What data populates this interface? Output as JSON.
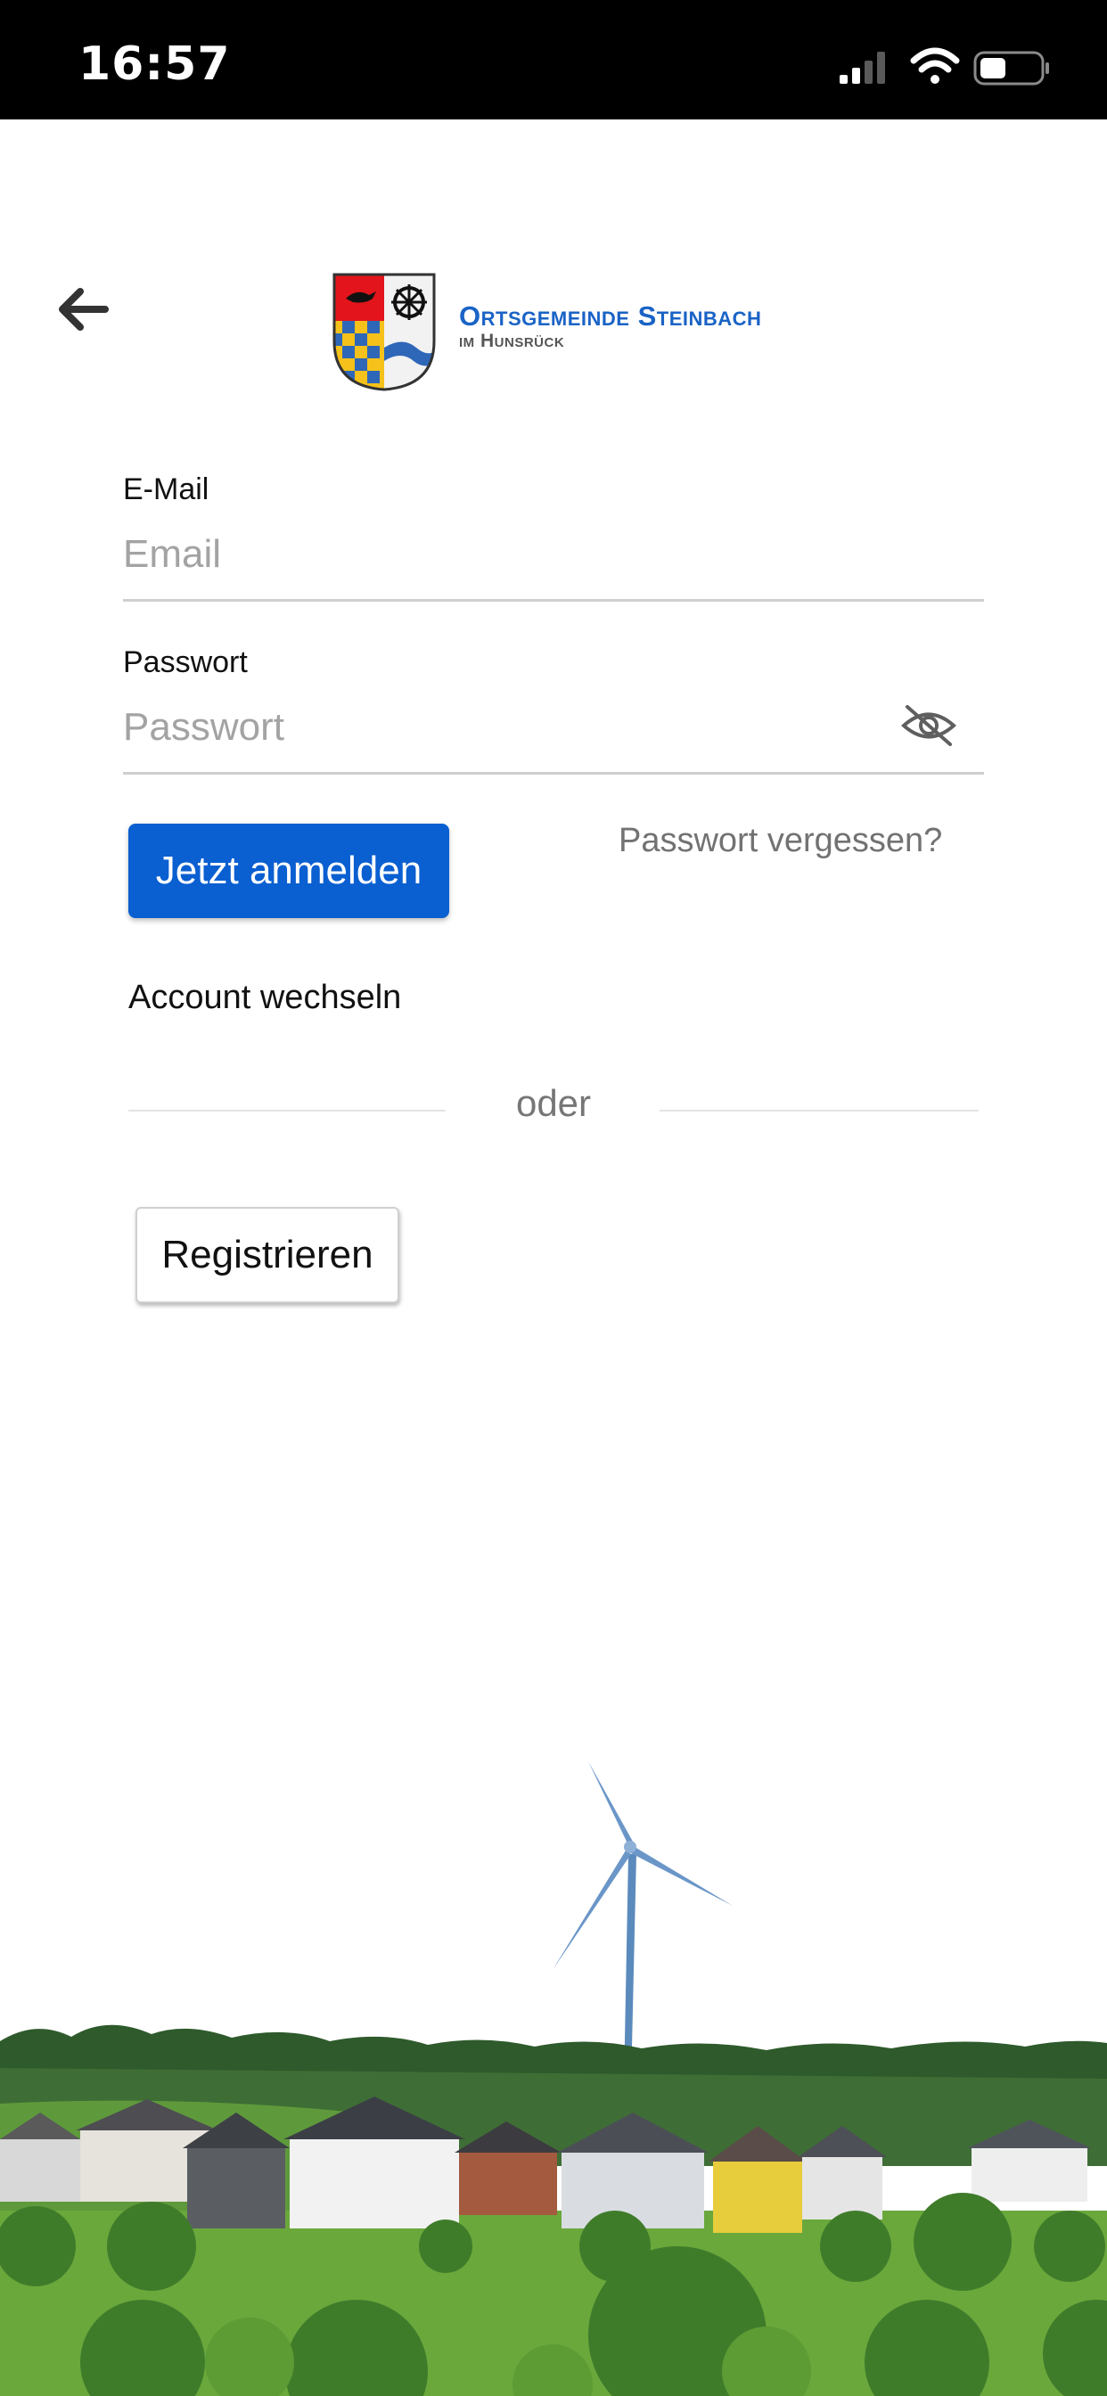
{
  "status_bar": {
    "time": "16:57"
  },
  "logo": {
    "title": "Ortsgemeinde Steinbach",
    "subtitle": "im Hunsrück"
  },
  "form": {
    "email": {
      "label": "E-Mail",
      "placeholder": "Email",
      "value": ""
    },
    "password": {
      "label": "Passwort",
      "placeholder": "Passwort",
      "value": ""
    },
    "login_button": "Jetzt anmelden",
    "forgot_link": "Passwort vergessen?",
    "switch_account": "Account wechseln",
    "divider_text": "oder",
    "register_button": "Registrieren"
  },
  "colors": {
    "primary": "#0a5fd1",
    "logo_blue": "#1a63c6",
    "status_bar": "#000000"
  },
  "icons": [
    "back-arrow-icon",
    "eye-off-icon",
    "signal-icon",
    "wifi-icon",
    "battery-icon",
    "coat-of-arms-icon"
  ]
}
